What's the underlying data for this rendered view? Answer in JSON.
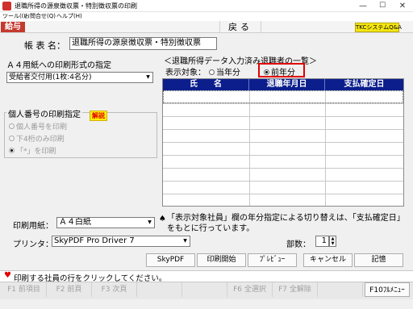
{
  "window": {
    "title": "退職所得の源泉徴収票・特別徴収票の印刷",
    "minimize": "—",
    "maximize": "☐",
    "close": "✕"
  },
  "menu": [
    "ツール(I)",
    "お問合せ(Q)",
    "ヘルプ(H)"
  ],
  "top": {
    "tag": "給与",
    "back": "戻る",
    "badge": "TKCシステムQ&A"
  },
  "form_name": {
    "label": "帳 表 名：",
    "value": "退職所得の源泉徴収票・特別徴収票"
  },
  "a4_format": {
    "label": "Ａ４用紙への印刷形式の指定",
    "value": "受給者交付用(1枚:4名分)"
  },
  "mynumber": {
    "label": "個人番号の印刷指定",
    "help": "解説",
    "options": [
      {
        "label": "個人番号を印刷",
        "selected": false
      },
      {
        "label": "下4桁のみ印刷",
        "selected": false
      },
      {
        "label": "「*」を印刷",
        "selected": true
      }
    ]
  },
  "list": {
    "title": "＜退職所得データ入力済み退職者の一覧＞",
    "display_label": "表示対象：",
    "options": [
      {
        "label": "当年分",
        "selected": false
      },
      {
        "label": "前年分",
        "selected": true
      }
    ],
    "columns": [
      "氏　　名",
      "退職年月日",
      "支払確定日"
    ],
    "rows": [],
    "highlight_color": "#e00000",
    "header_color": "#0b1e8c"
  },
  "paper": {
    "label": "印刷用紙：",
    "value": "Ａ４白紙"
  },
  "printer": {
    "label": "プリンタ：",
    "value": "SkyPDF Pro Driver 7"
  },
  "note": {
    "mark": "♠",
    "text": "「表示対象社員」欄の年分指定による切り替えは、「支払確定日」をもとに行っています。"
  },
  "copies": {
    "label": "部数：",
    "value": "1"
  },
  "buttons": [
    "SkyPDF",
    "印刷開始",
    "ﾌﾟﾚﾋﾞｭｰ",
    "キャンセル",
    "記憶"
  ],
  "status": {
    "mark": "♥",
    "text": "印刷する社員の行をクリックしてください。"
  },
  "fkeys": [
    "F1 前項目",
    "F2 前頁",
    "F3 次頁",
    "",
    "",
    "F6 全選択",
    "F7 全解除",
    "",
    "F10ﾌﾙﾒﾆｭｰ"
  ]
}
